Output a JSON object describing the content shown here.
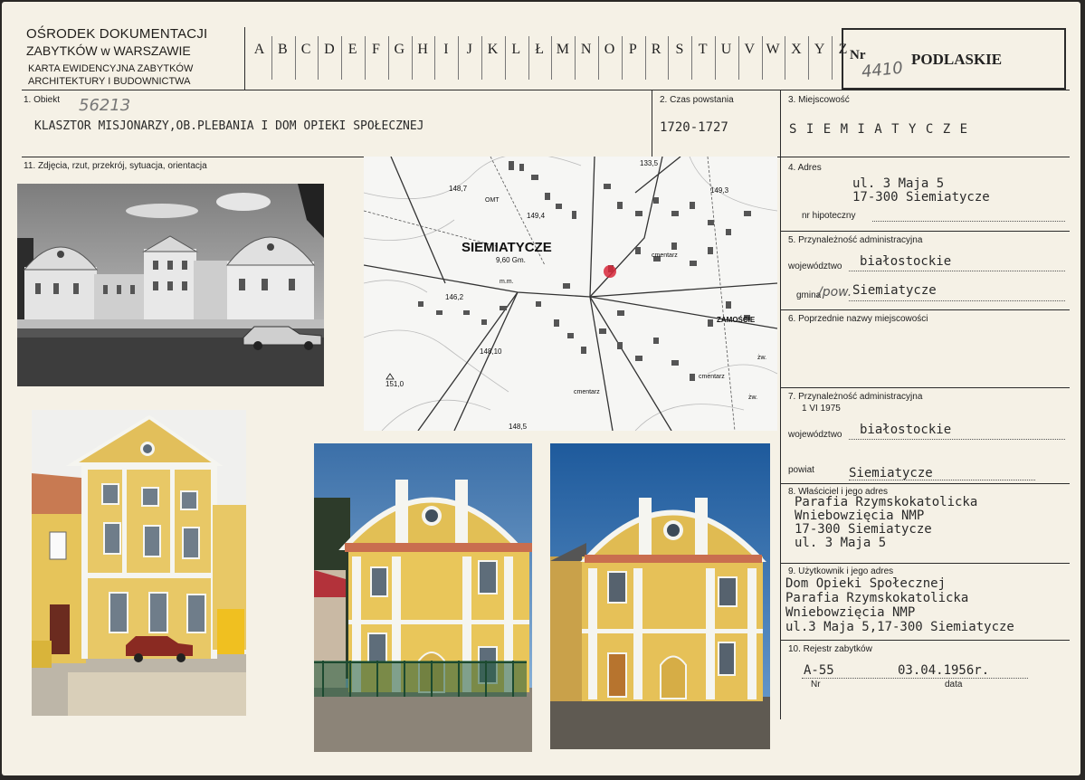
{
  "header": {
    "institution_line1": "OŚRODEK DOKUMENTACJI",
    "institution_line2": "ZABYTKÓW w WARSZAWIE",
    "card_line1": "KARTA EWIDENCYJNA ZABYTKÓW",
    "card_line2": "ARCHITEKTURY I BUDOWNICTWA",
    "alphabet": [
      "A",
      "B",
      "C",
      "D",
      "E",
      "F",
      "G",
      "H",
      "I",
      "J",
      "K",
      "L",
      "Ł",
      "M",
      "N",
      "O",
      "P",
      "R",
      "S",
      "T",
      "U",
      "V",
      "W",
      "X",
      "Y",
      "Z"
    ],
    "nr_label": "Nr",
    "nr_value": "4410",
    "region": "PODLASKIE"
  },
  "fields": {
    "obiekt_label": "1. Obiekt",
    "obiekt_hand_number": "56213",
    "obiekt_value": "KLASZTOR MISJONARZY,OB.PLEBANIA I DOM OPIEKI SPOŁECZNEJ",
    "czas_label": "2. Czas powstania",
    "czas_value": "1720-1727",
    "miejscowosc_label": "3. Miejscowość",
    "miejscowosc_value": "S I E M I A T Y C Z E",
    "zdjecia_label": "11. Zdjęcia, rzut, przekrój, sytuacja, orientacja",
    "adres_label": "4. Adres",
    "adres_line1": "ul. 3 Maja 5",
    "adres_line2": "17-300 Siemiatycze",
    "hipoteczny_label": "nr hipoteczny",
    "przyn5_label": "5. Przynależność administracyjna",
    "woj_label": "województwo",
    "woj5_value": "białostockie",
    "gmina_label": "gmina",
    "gmina_hand": "/pow.",
    "gmina_value": "Siemiatycze",
    "poprzednie_label": "6. Poprzednie nazwy miejscowości",
    "przyn7_label": "7. Przynależność administracyjna",
    "przyn7_date": "1 VI 1975",
    "woj7_value": "białostockie",
    "powiat_label": "powiat",
    "powiat_value": "Siemiatycze",
    "wlasciciel_label": "8. Właściciel i jego adres",
    "wlasciciel_lines": [
      "Parafia Rzymskokatolicka",
      "Wniebowzięcia NMP",
      "17-300 Siemiatycze",
      "ul. 3 Maja 5"
    ],
    "uzytkownik_label": "9. Użytkownik i jego adres",
    "uzytkownik_lines": [
      "Dom Opieki Społecznej",
      "Parafia Rzymskokatolicka",
      "Wniebowzięcia NMP",
      "ul.3 Maja 5,17-300 Siemiatycze"
    ],
    "rejestr_label": "10. Rejestr zabytków",
    "rejestr_nr_value": "A-55",
    "rejestr_data_value": "03.04.1956r.",
    "rejestr_nr_label": "Nr",
    "rejestr_data_label": "data"
  },
  "map": {
    "town_label": "SIEMIATYCZE",
    "gm_label": "9,60 Gm.",
    "zamoscie_label": "ZAMOŚCIE",
    "heights": [
      "148,7",
      "133,5",
      "149,3",
      "149,4",
      "146,2",
      "148,10",
      "151,0",
      "148,5"
    ],
    "small_labels": [
      "OMT",
      "m.m.",
      "cmentarz",
      "cmentarz",
      "cmentarz",
      "żw.",
      "żw."
    ]
  }
}
